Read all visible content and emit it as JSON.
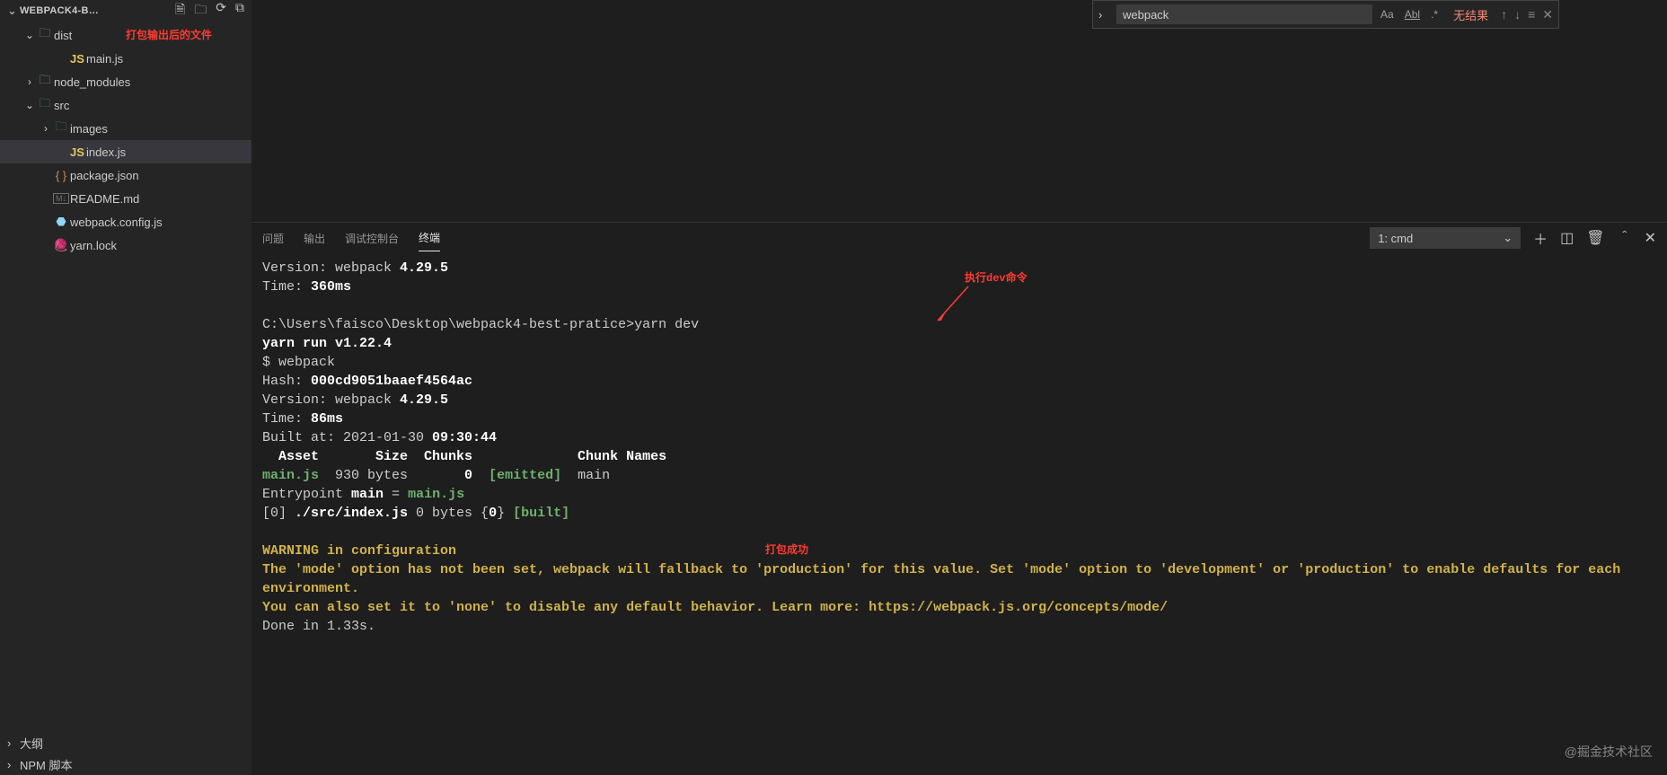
{
  "explorer": {
    "title": "WEBPACK4-B…",
    "actions": [
      "new-file",
      "new-folder",
      "refresh",
      "collapse-all"
    ],
    "tree": [
      {
        "type": "folder",
        "name": "dist",
        "icon": "folder-dist",
        "depth": 1,
        "expanded": true
      },
      {
        "type": "file",
        "name": "main.js",
        "icon": "js",
        "depth": 3
      },
      {
        "type": "folder",
        "name": "node_modules",
        "icon": "folder-node",
        "depth": 1,
        "expanded": false
      },
      {
        "type": "folder",
        "name": "src",
        "icon": "folder-src",
        "depth": 1,
        "expanded": true
      },
      {
        "type": "folder",
        "name": "images",
        "icon": "folder-images",
        "depth": 2,
        "expanded": false
      },
      {
        "type": "file",
        "name": "index.js",
        "icon": "js",
        "depth": 3,
        "selected": true
      },
      {
        "type": "file",
        "name": "package.json",
        "icon": "json",
        "depth": 2
      },
      {
        "type": "file",
        "name": "README.md",
        "icon": "md",
        "depth": 2
      },
      {
        "type": "file",
        "name": "webpack.config.js",
        "icon": "webpack",
        "depth": 2
      },
      {
        "type": "file",
        "name": "yarn.lock",
        "icon": "yarn",
        "depth": 2
      }
    ],
    "bottom": [
      "大纲",
      "NPM 脚本"
    ]
  },
  "annotations": {
    "dist_note": "打包输出后的文件",
    "dev_note": "执行dev命令",
    "success_note": "打包成功"
  },
  "search": {
    "value": "webpack",
    "opts": {
      "case": "Aa",
      "word": "Abl",
      "regex": ".*"
    },
    "result": "无结果"
  },
  "panel": {
    "tabs": [
      "问题",
      "输出",
      "调试控制台",
      "终端"
    ],
    "active_tab": 3,
    "dropdown": "1: cmd"
  },
  "terminal": {
    "l1a": "Version: webpack ",
    "l1b": "4.29.5",
    "l2a": "Time: ",
    "l2b": "360ms",
    "l3": "C:\\Users\\faisco\\Desktop\\webpack4-best-pratice>yarn dev",
    "l4": "yarn run v1.22.4",
    "l5": "$ webpack",
    "l6a": "Hash: ",
    "l6b": "000cd9051baaef4564ac",
    "l7a": "Version: webpack ",
    "l7b": "4.29.5",
    "l8a": "Time: ",
    "l8b": "86ms",
    "l9a": "Built at: 2021-01-30 ",
    "l9b": "09:30:44",
    "l10": "  Asset       Size  Chunks             Chunk Names",
    "l11a": "main.js",
    "l11b": "  930 bytes       ",
    "l11c": "0",
    "l11d": "  ",
    "l11e": "[emitted]",
    "l11f": "  main",
    "l12a": "Entrypoint ",
    "l12b": "main",
    "l12c": " = ",
    "l12d": "main.js",
    "l13a": "[0] ",
    "l13b": "./src/index.js",
    "l13c": " 0 bytes {",
    "l13d": "0",
    "l13e": "} ",
    "l13f": "[built]",
    "l14": "WARNING in configuration",
    "l15": "The 'mode' option has not been set, webpack will fallback to 'production' for this value. Set 'mode' option to 'development' or 'production' to enable defaults for each environment.",
    "l16": "You can also set it to 'none' to disable any default behavior. Learn more: https://webpack.js.org/concepts/mode/",
    "l17": "Done in 1.33s."
  },
  "watermark": "@掘金技术社区"
}
